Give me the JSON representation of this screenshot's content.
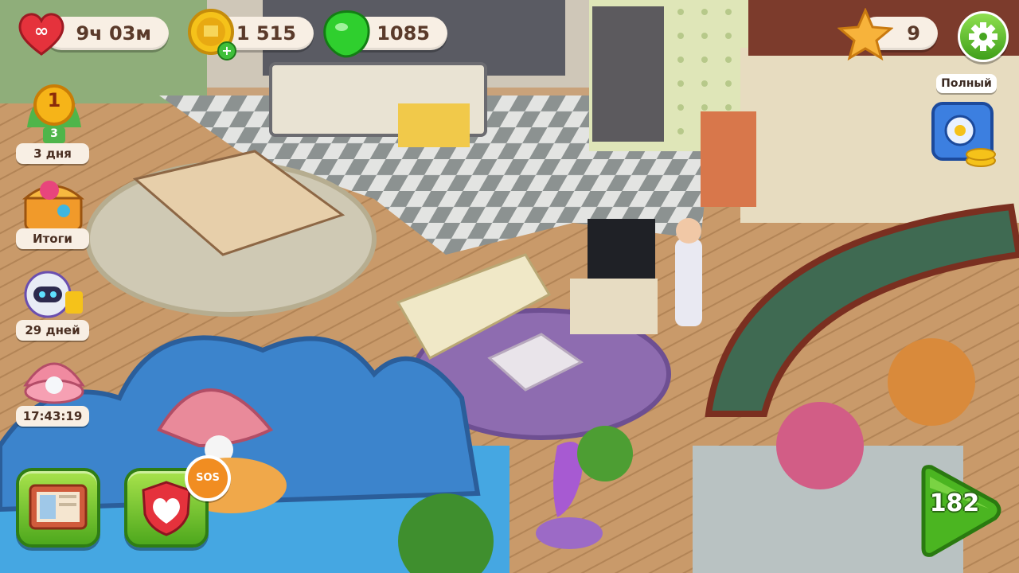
{
  "hud": {
    "lives": {
      "icon": "heart-infinity-icon",
      "value": "9ч 03м"
    },
    "coins": {
      "icon": "coin-icon",
      "value": "1 515"
    },
    "gems": {
      "icon": "green-gem-icon",
      "value": "1085"
    },
    "stars": {
      "icon": "star-icon",
      "value": "9"
    },
    "settings": {
      "icon": "gear-icon"
    }
  },
  "side_events": [
    {
      "id": "event-rank",
      "icon": "rank-medal-icon",
      "badge": "1",
      "sub": "3",
      "label": "3 дня"
    },
    {
      "id": "event-results",
      "icon": "treasure-chest-icon",
      "label": "Итоги"
    },
    {
      "id": "event-robot",
      "icon": "robot-astronaut-icon",
      "label": "29 дней"
    },
    {
      "id": "event-pearl",
      "icon": "pearl-shell-icon",
      "label": "17:43:19"
    }
  ],
  "piggy_bank": {
    "icon": "safe-coins-icon",
    "label": "Полный"
  },
  "bottom": {
    "design_button": {
      "icon": "design-book-icon"
    },
    "heart_button": {
      "icon": "heart-shield-icon"
    },
    "sos_badge": {
      "icon": "sos-badge-icon",
      "label": "SOS"
    },
    "play_button": {
      "icon": "play-arrow-icon",
      "level": "182"
    }
  },
  "colors": {
    "accent_green": "#4ea81d",
    "heart_red": "#e5323c",
    "coin_gold": "#f5c21a",
    "panel_cream": "#f8efe4"
  }
}
